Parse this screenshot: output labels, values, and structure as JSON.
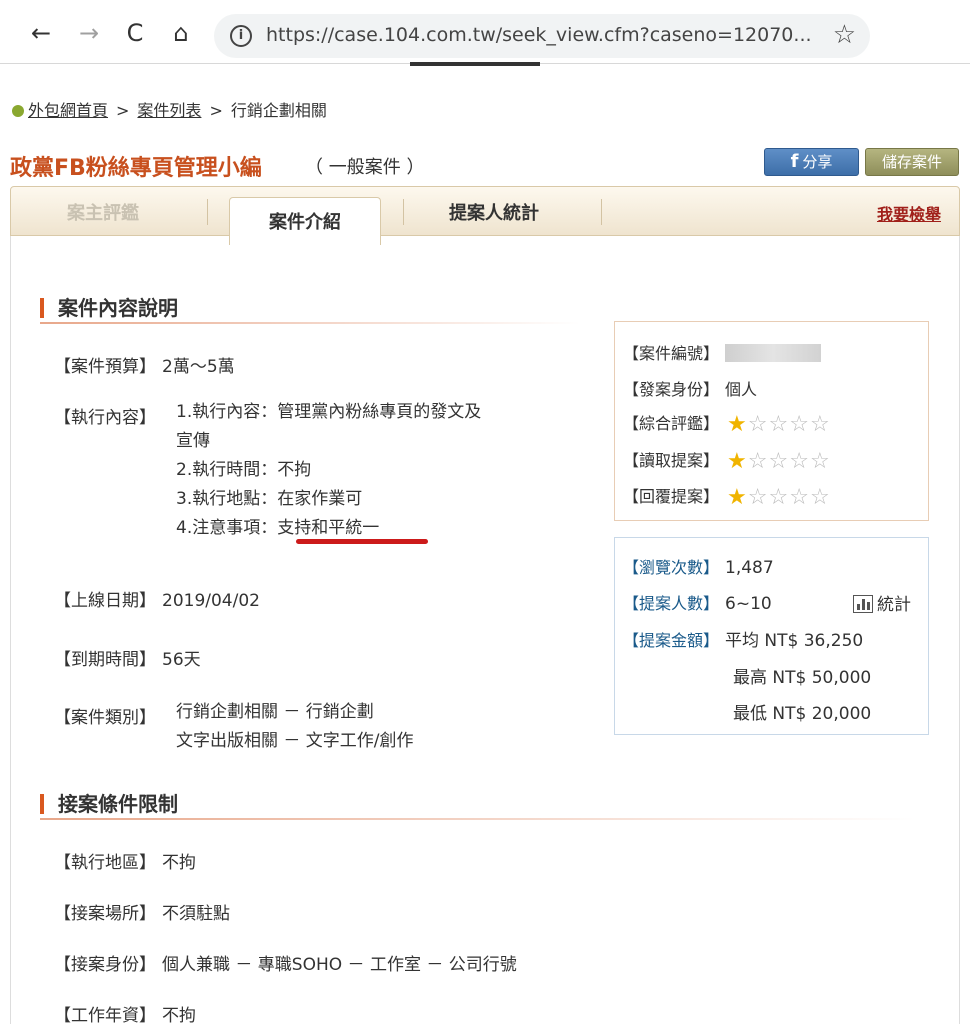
{
  "browser": {
    "url": "https://case.104.com.tw/seek_view.cfm?caseno=12070...",
    "back_icon": "←",
    "forward_icon": "→",
    "reload_icon": "C",
    "home_icon": "⌂",
    "info_icon": "i",
    "bookmark_icon": "☆"
  },
  "breadcrumb": {
    "home": "外包網首頁",
    "sep1": ">",
    "list": "案件列表",
    "sep2": ">",
    "current": "行銷企劃相關"
  },
  "header": {
    "title": "政黨FB粉絲專頁管理小編",
    "type": "（ 一般案件 ）",
    "share_icon": "f",
    "share_label": "分享",
    "save_label": "儲存案件"
  },
  "tabs": {
    "review": "案主評鑑",
    "intro": "案件介紹",
    "stats": "提案人統計",
    "report": "我要檢舉"
  },
  "section1": {
    "title": "案件內容說明",
    "budget_label": "【案件預算】",
    "budget_value": "2萬～5萬",
    "content_label": "【執行內容】",
    "content_lines": [
      "1.執行內容：管理黨內粉絲專頁的發文及",
      "宣傳",
      "2.執行時間：不拘",
      "3.執行地點：在家作業可"
    ],
    "note_prefix": "4.注意事項：",
    "note_value": "支持和平統一",
    "online_label": "【上線日期】",
    "online_value": "2019/04/02",
    "expire_label": "【到期時間】",
    "expire_value": "56天",
    "category_label": "【案件類別】",
    "category_lines": [
      "行銷企劃相關 － 行銷企劃",
      "文字出版相關 － 文字工作/創作"
    ]
  },
  "section2": {
    "title": "接案條件限制",
    "area_label": "【執行地區】",
    "area_value": "不拘",
    "place_label": "【接案場所】",
    "place_value": "不須駐點",
    "identity_label": "【接案身份】",
    "identity_value": "個人兼職 － 專職SOHO － 工作室 － 公司行號",
    "years_label": "【工作年資】",
    "years_value": "不拘"
  },
  "info_box": {
    "caseno_label": "【案件編號】",
    "identity_label": "【發案身份】",
    "identity_value": "個人",
    "rating_label": "【綜合評鑑】",
    "read_label": "【讀取提案】",
    "reply_label": "【回覆提案】",
    "rating_stars": 1,
    "read_stars": 1,
    "reply_stars": 1,
    "star_on": "★",
    "star_off": "☆"
  },
  "stat_box": {
    "views_label": "【瀏覽次數】",
    "views_value": "1,487",
    "proposers_label": "【提案人數】",
    "proposers_value": "6~10",
    "stats_link": "統計",
    "amount_label": "【提案金額】",
    "avg": "平均 NT$ 36,250",
    "max": "最高 NT$ 50,000",
    "min": "最低 NT$ 20,000"
  },
  "colors": {
    "title": "#c8501e",
    "section_bar": "#d9581f",
    "star_on": "#f0b400",
    "red_mark": "#cc1a1a"
  }
}
